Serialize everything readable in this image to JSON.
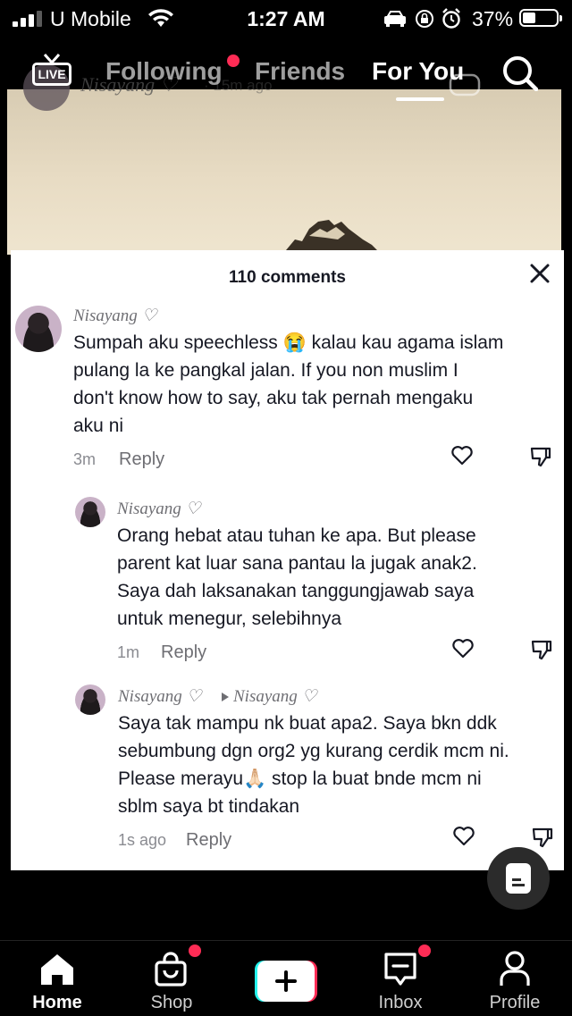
{
  "status_bar": {
    "carrier": "U Mobile",
    "time": "1:27 AM",
    "battery": "37%",
    "battery_level": 0.37,
    "icons": [
      "signal-icon",
      "wifi-icon",
      "car-icon",
      "lock-rotation-icon",
      "alarm-icon",
      "battery-icon"
    ]
  },
  "top_nav": {
    "live_label": "LIVE",
    "tabs": [
      {
        "label": "Following",
        "has_badge": true
      },
      {
        "label": "Friends"
      },
      {
        "label": "For You",
        "active": true
      }
    ],
    "search_icon": "search-icon"
  },
  "video_overlay": {
    "username": "Nisayang ♡",
    "ago": "· 15m ago"
  },
  "comments_sheet": {
    "title": "110 comments",
    "close_icon": "close-icon",
    "comments": [
      {
        "username": "Nisayang ♡",
        "text": [
          "Sumpah aku speechless 😭 kalau kau agama islam",
          "pulang la ke pangkal jalan. If you non muslim I",
          "don't know how to say, aku tak pernah mengaku",
          "aku ni"
        ],
        "time": "3m",
        "reply_label": "Reply"
      },
      {
        "username": "Nisayang ♡",
        "text": [
          "Orang hebat atau tuhan ke apa. But please",
          "parent kat luar sana pantau la jugak anak2.",
          "Saya dah laksanakan tanggungjawab saya",
          "untuk menegur, selebihnya"
        ],
        "time": "1m",
        "reply_label": "Reply"
      },
      {
        "username": "Nisayang ♡",
        "reply_to": "Nisayang ♡",
        "text": [
          "Saya tak mampu nk buat apa2. Saya bkn ddk",
          "sebumbung dgn org2 yg kurang cerdik mcm ni.",
          "Please merayu🙏🏻 stop la buat bnde mcm ni",
          "sblm saya bt tindakan"
        ],
        "time": "1s ago",
        "reply_label": "Reply"
      }
    ]
  },
  "bottom_tabs": [
    {
      "label": "Home",
      "icon": "home-icon",
      "active": true
    },
    {
      "label": "Shop",
      "icon": "shop-bag-icon",
      "has_badge": true
    },
    {
      "label": "",
      "icon": "create-plus-icon"
    },
    {
      "label": "Inbox",
      "icon": "inbox-icon",
      "has_badge": true
    },
    {
      "label": "Profile",
      "icon": "profile-icon"
    }
  ],
  "colors": {
    "accent_badge": "#fe2c55",
    "plus_left": "#25f4ee",
    "plus_right": "#fe2c55"
  }
}
